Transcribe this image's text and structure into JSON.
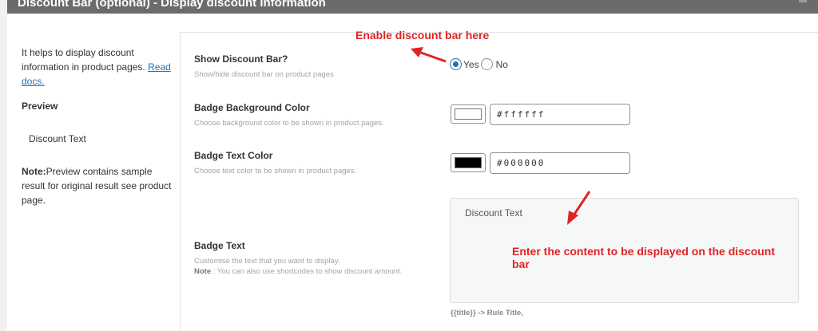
{
  "header": {
    "title": "Discount Bar (optional) - Display discount information"
  },
  "sidebar": {
    "help_text": "It helps to display discount information in product pages.",
    "read_docs": "Read docs.",
    "preview_title": "Preview",
    "preview_text": "Discount Text",
    "note_label": "Note:",
    "note_text": "Preview contains sample result for original result see product page."
  },
  "fields": {
    "show_bar": {
      "label": "Show Discount Bar?",
      "desc": "Show/hide discount bar on product pages",
      "options": [
        "Yes",
        "No"
      ],
      "selected": "Yes"
    },
    "bg_color": {
      "label": "Badge Background Color",
      "desc": "Choose background color to be shown in product pages.",
      "value": "#ffffff"
    },
    "text_color": {
      "label": "Badge Text Color",
      "desc": "Choose text color to be shown in product pages.",
      "value": "#000000"
    },
    "badge_text": {
      "label": "Badge Text",
      "desc": "Customise the text that you want to display.",
      "note_label": "Note",
      "note_text": " : You can also use shortcodes to show discount amount.",
      "value": "Discount Text",
      "shortcode_hint": "{{title}} -> Rule Title,"
    }
  },
  "annotations": {
    "enable": "Enable discount bar here",
    "content_line1": "Enter the content to be displayed on the discount",
    "content_line2": "bar"
  },
  "colors": {
    "accent": "#2271b1",
    "annotation": "#e02424",
    "header_bg": "#6b6b6b"
  }
}
